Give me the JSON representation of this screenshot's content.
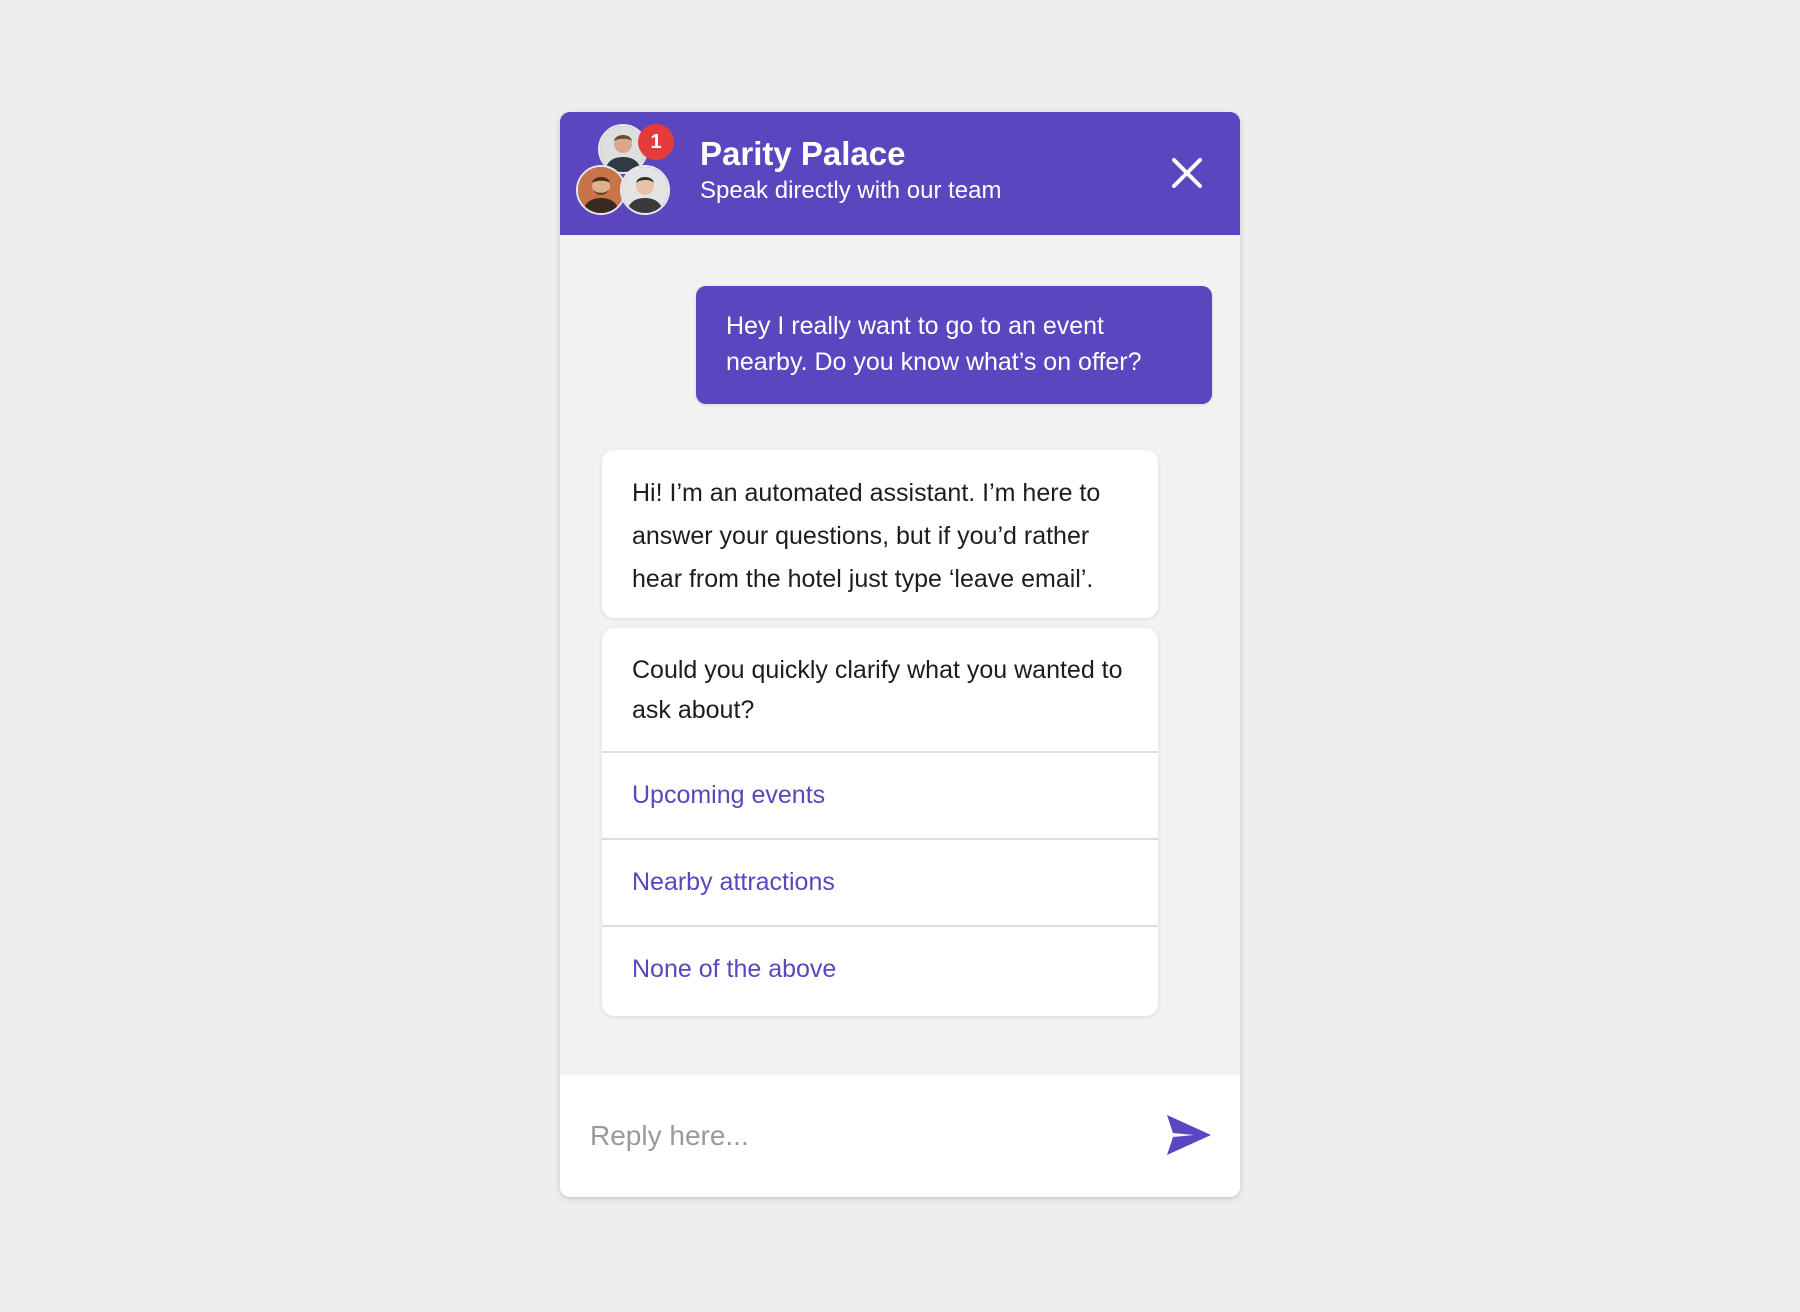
{
  "header": {
    "title": "Parity Palace",
    "subtitle": "Speak directly with our team",
    "notification_count": "1",
    "close_icon": "close-icon",
    "avatar_count": 3
  },
  "messages": {
    "user": "Hey I really want to go to an event nearby. Do you know what’s on offer?",
    "bot_intro": "Hi! I’m an automated assistant. I’m here to answer your questions, but if you’d rather hear from the hotel just type ‘leave email’.",
    "bot_question": "Could you quickly clarify what you wanted to ask about?",
    "options": [
      {
        "label": "Upcoming events"
      },
      {
        "label": "Nearby attractions"
      },
      {
        "label": "None of the above"
      }
    ]
  },
  "reply": {
    "placeholder": "Reply here...",
    "send_icon": "send-icon"
  },
  "colors": {
    "accent": "#5b46bf",
    "badge": "#e63b3b",
    "background": "#eeeeee",
    "chat_background": "#f2f2f2"
  }
}
